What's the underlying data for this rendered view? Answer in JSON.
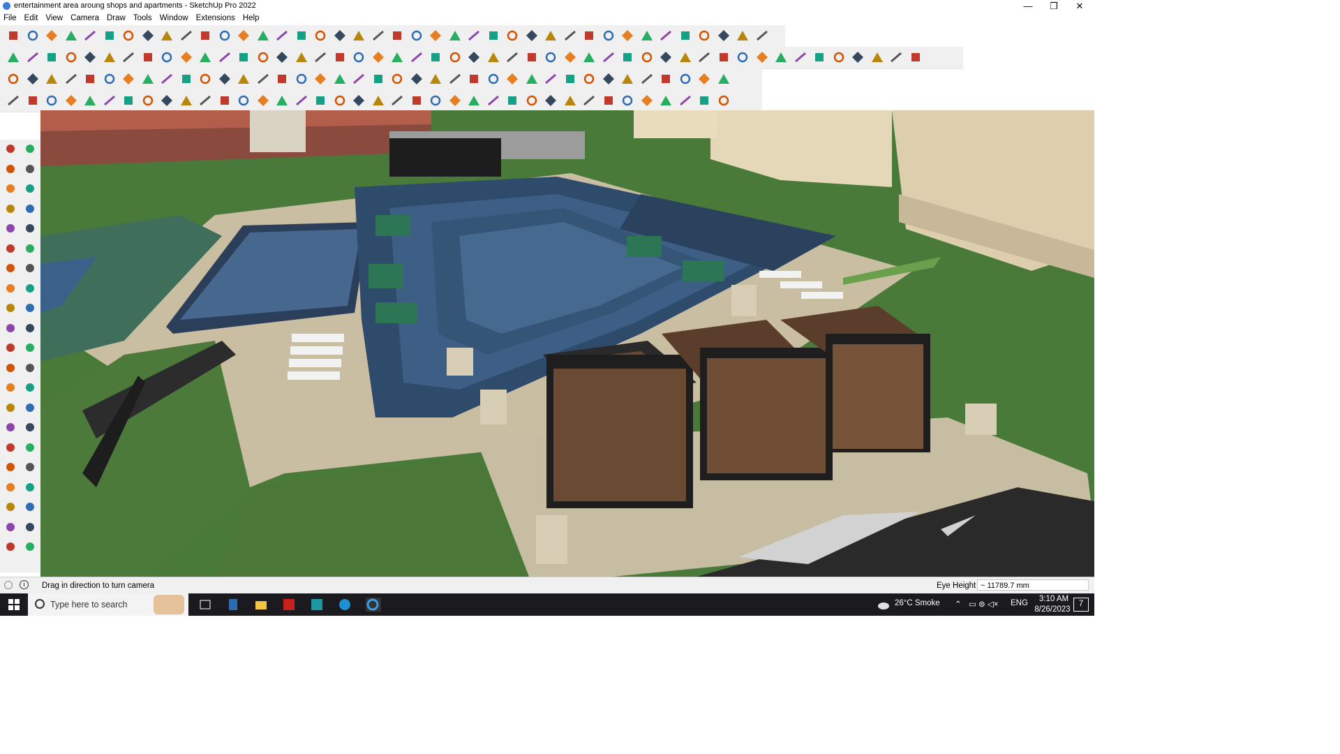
{
  "window": {
    "title": "entertainment area aroung shops and apartments - SketchUp Pro 2022",
    "minimize": "—",
    "restore": "❐",
    "close": "✕"
  },
  "menu": [
    "File",
    "Edit",
    "View",
    "Camera",
    "Draw",
    "Tools",
    "Window",
    "Extensions",
    "Help"
  ],
  "status": {
    "hint": "Drag in direction to turn camera",
    "measure_label": "Eye Height",
    "measure_value": "~ 11789.7 mm"
  },
  "taskbar": {
    "search_placeholder": "Type here to search",
    "weather": "26°C  Smoke",
    "language": "ENG",
    "time": "3:10 AM",
    "date": "8/26/2023",
    "notifications": "7"
  },
  "colors": {
    "grass": "#4d7a3b",
    "water": "#3a5f84",
    "paving": "#c9bea2",
    "wood": "#6b4a34",
    "frame": "#1e1e1e"
  }
}
